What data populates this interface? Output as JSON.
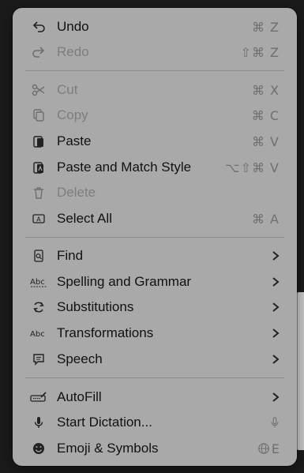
{
  "menu": {
    "items": [
      {
        "label": "Undo",
        "shortcut": "⌘ Z",
        "icon": "undo-icon",
        "disabled": false
      },
      {
        "label": "Redo",
        "shortcut": "⇧⌘ Z",
        "icon": "redo-icon",
        "disabled": true
      },
      {
        "label": "Cut",
        "shortcut": "⌘ X",
        "icon": "scissors-icon",
        "disabled": true
      },
      {
        "label": "Copy",
        "shortcut": "⌘ C",
        "icon": "copy-icon",
        "disabled": true
      },
      {
        "label": "Paste",
        "shortcut": "⌘ V",
        "icon": "paste-icon",
        "disabled": false
      },
      {
        "label": "Paste and Match Style",
        "shortcut": "⌥⇧⌘ V",
        "icon": "paste-match-style-icon",
        "disabled": false
      },
      {
        "label": "Delete",
        "shortcut": "",
        "icon": "trash-icon",
        "disabled": true
      },
      {
        "label": "Select All",
        "shortcut": "⌘ A",
        "icon": "select-all-icon",
        "disabled": false
      },
      {
        "label": "Find",
        "shortcut": "",
        "icon": "find-icon",
        "disabled": false
      },
      {
        "label": "Spelling and Grammar",
        "shortcut": "",
        "icon": "spelling-abc-icon",
        "disabled": false
      },
      {
        "label": "Substitutions",
        "shortcut": "",
        "icon": "substitutions-icon",
        "disabled": false
      },
      {
        "label": "Transformations",
        "shortcut": "",
        "icon": "transformations-abc-icon",
        "disabled": false
      },
      {
        "label": "Speech",
        "shortcut": "",
        "icon": "speech-bubble-icon",
        "disabled": false
      },
      {
        "label": "AutoFill",
        "shortcut": "",
        "icon": "autofill-icon",
        "disabled": false
      },
      {
        "label": "Start Dictation...",
        "shortcut": "",
        "icon": "microphone-icon",
        "disabled": false
      },
      {
        "label": "Emoji & Symbols",
        "shortcut": "",
        "icon": "emoji-icon",
        "disabled": false
      }
    ],
    "shortcut_icons": {
      "dictation": "microphone-icon",
      "emoji": "globe-icon"
    },
    "trailing_letter_emoji": "E"
  }
}
